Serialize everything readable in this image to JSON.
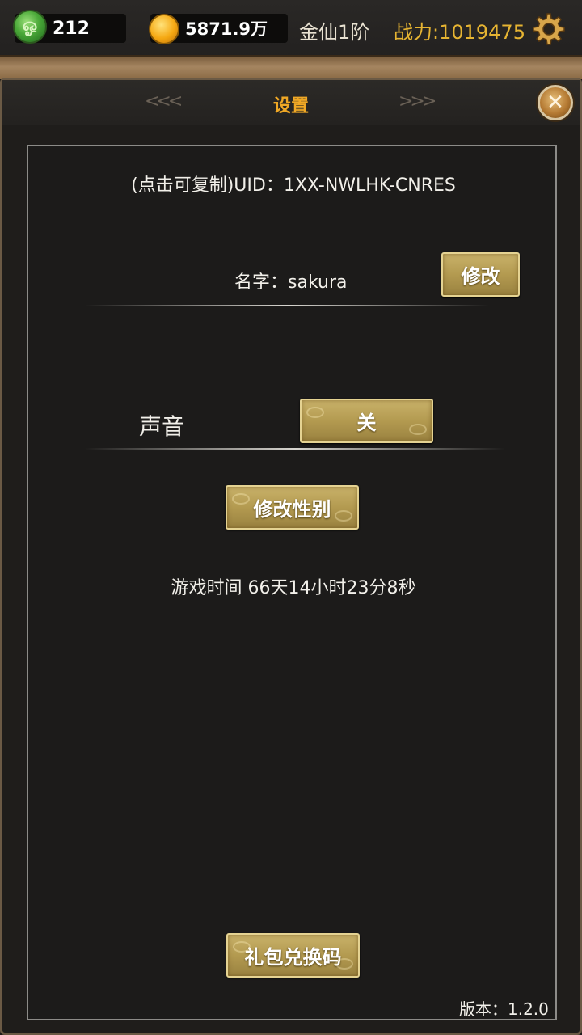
{
  "topbar": {
    "jade_count": "212",
    "gold_amount": "5871.9万",
    "rank": "金仙1阶",
    "power": "战力:1019475"
  },
  "dialog": {
    "title": "设置",
    "close_label": "✕"
  },
  "settings": {
    "uid_text": "(点击可复制)UID：1XX-NWLHK-CNRES",
    "name_text": "名字：sakura",
    "modify_name_button": "修改",
    "sound_label": "声音",
    "sound_toggle_button": "关",
    "modify_gender_button": "修改性别",
    "play_time_text": "游戏时间 66天14小时23分8秒",
    "gift_code_button": "礼包兑换码",
    "version_text": "版本：1.2.0"
  },
  "colors": {
    "accent_gold": "#f0a825",
    "power_gold": "#e6b432",
    "button_gold": "#b39a50",
    "panel_border": "#8c8b88"
  },
  "icons": {
    "jade": "jade-icon",
    "coin": "gold-coin-icon",
    "settings": "gear-icon",
    "close": "close-icon"
  }
}
